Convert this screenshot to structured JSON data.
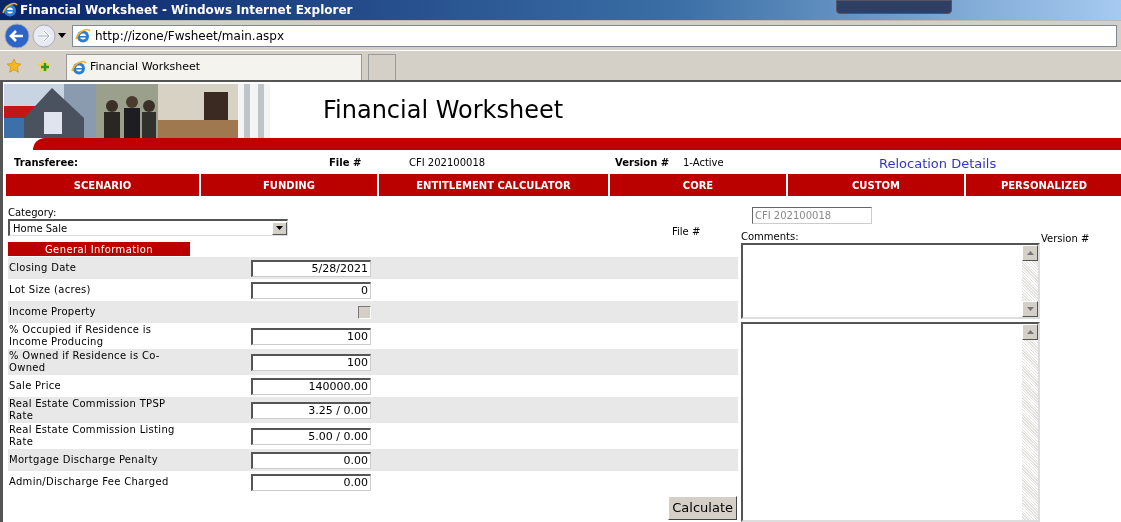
{
  "window": {
    "title": "Financial Worksheet - Windows Internet Explorer"
  },
  "address_bar": {
    "url": "http://izone/Fwsheet/main.aspx"
  },
  "tabs": [
    {
      "label": "Financial Worksheet",
      "selected": true
    }
  ],
  "page": {
    "title": "Financial Worksheet",
    "info": {
      "transferee_label": "Transferee:",
      "file_label": "File #",
      "file_value": "CFI 202100018",
      "version_label": "Version #",
      "version_value": "1-Active",
      "link": "Relocation Details"
    },
    "nav": [
      {
        "label": "SCENARIO"
      },
      {
        "label": "FUNDING"
      },
      {
        "label": "ENTITLEMENT CALCULATOR"
      },
      {
        "label": "CORE"
      },
      {
        "label": "CUSTOM"
      },
      {
        "label": "PERSONALIZED"
      }
    ],
    "category": {
      "label": "Category:",
      "value": "Home Sale"
    },
    "file_field": {
      "label": "File #",
      "value": "CFI 202100018",
      "disabled": true
    },
    "version_label": "Version #",
    "section_title": "General Information",
    "rows": [
      {
        "kind": "text",
        "label": "Closing Date",
        "value": "5/28/2021"
      },
      {
        "kind": "text",
        "label": "Lot Size (acres)",
        "value": "0"
      },
      {
        "kind": "checkbox",
        "label": "Income Property",
        "checked": false
      },
      {
        "kind": "text",
        "label": "% Occupied if Residence is Income Producing",
        "value": "100"
      },
      {
        "kind": "text",
        "label": "% Owned if Residence is Co-Owned",
        "value": "100"
      },
      {
        "kind": "text",
        "label": "Sale Price",
        "value": "140000.00"
      },
      {
        "kind": "text",
        "label": "Real Estate Commission TPSP Rate",
        "value": "3.25 / 0.00"
      },
      {
        "kind": "text",
        "label": "Real Estate Commission Listing Rate",
        "value": "5.00 / 0.00"
      },
      {
        "kind": "text",
        "label": "Mortgage Discharge Penalty",
        "value": "0.00"
      },
      {
        "kind": "text",
        "label": "Admin/Discharge Fee Charged",
        "value": "0.00"
      }
    ],
    "calculate_button": "Calculate",
    "comments_label": "Comments:"
  }
}
